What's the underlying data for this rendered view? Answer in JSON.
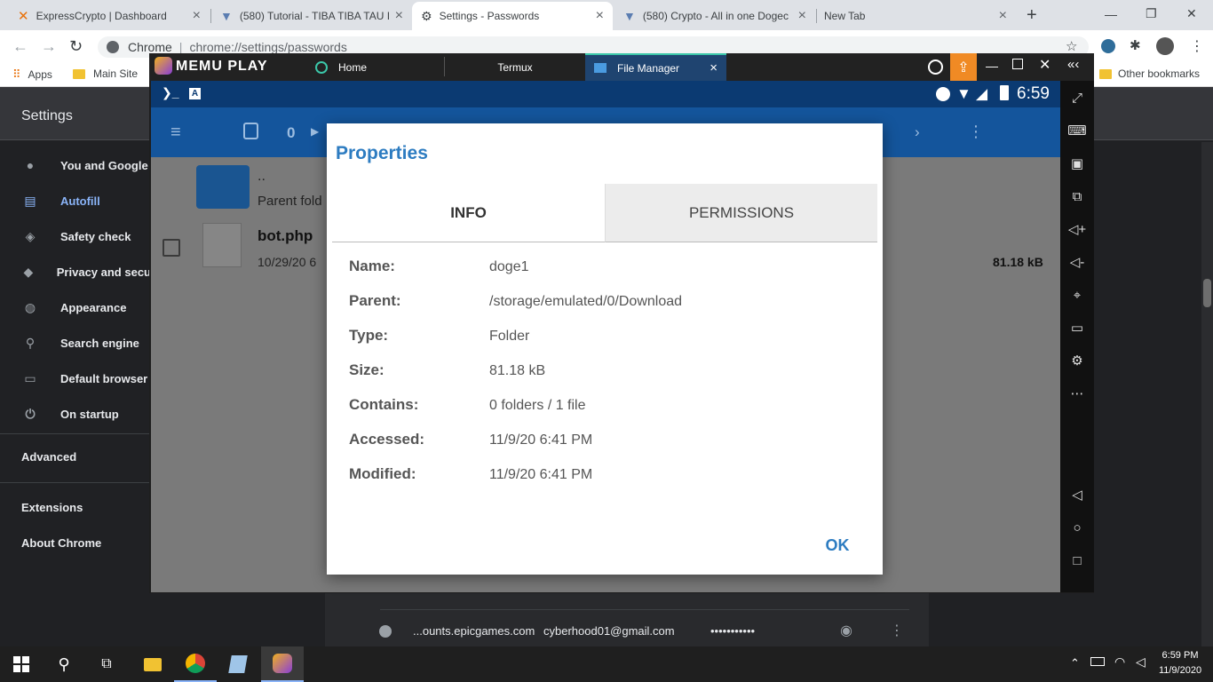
{
  "browser": {
    "tabs": [
      {
        "title": "ExpressCrypto | Dashboard",
        "icon": "expresscrypto-icon"
      },
      {
        "title": "(580) Tutorial - TIBA TIBA TAU I",
        "icon": "youtube-icon"
      },
      {
        "title": "Settings - Passwords",
        "icon": "gear-icon"
      },
      {
        "title": "(580) Crypto - All in one Dogec",
        "icon": "youtube-icon"
      },
      {
        "title": "New Tab",
        "icon": ""
      }
    ],
    "new_tab": "+",
    "window_controls": {
      "minimize": "—",
      "restore": "❐",
      "close": "✕"
    },
    "site_label": "Chrome",
    "url": "chrome://settings/passwords",
    "bookmarks": {
      "apps": "Apps",
      "main_site": "Main Site",
      "other": "Other bookmarks"
    }
  },
  "settings": {
    "title": "Settings",
    "nav": [
      {
        "label": "You and Google",
        "icon": "person-icon"
      },
      {
        "label": "Autofill",
        "icon": "clipboard-icon",
        "active": true
      },
      {
        "label": "Safety check",
        "icon": "shield-check-icon"
      },
      {
        "label": "Privacy and secu",
        "icon": "shield-icon"
      },
      {
        "label": "Appearance",
        "icon": "palette-icon"
      },
      {
        "label": "Search engine",
        "icon": "search-icon"
      },
      {
        "label": "Default browser",
        "icon": "browser-icon"
      },
      {
        "label": "On startup",
        "icon": "power-icon"
      }
    ],
    "advanced": "Advanced",
    "extensions": "Extensions",
    "about": "About Chrome",
    "password_row": {
      "site": "...ounts.epicgames.com",
      "user": "cyberhood01@gmail.com",
      "password": "•••••••••••"
    }
  },
  "memu": {
    "brand": "MEMU PLAY",
    "tabs": [
      {
        "label": "Home"
      },
      {
        "label": "Termux"
      },
      {
        "label": "File Manager"
      }
    ],
    "status_time": "6:59",
    "toolbar_count": "0",
    "files": [
      {
        "name": "..",
        "sub": "Parent fold"
      },
      {
        "name": "bot.php",
        "sub": "10/29/20 6",
        "size": "81.18 kB"
      }
    ]
  },
  "dialog": {
    "title": "Properties",
    "tabs": {
      "info": "INFO",
      "permissions": "PERMISSIONS"
    },
    "rows": [
      {
        "label": "Name:",
        "value": "doge1"
      },
      {
        "label": "Parent:",
        "value": "/storage/emulated/0/Download"
      },
      {
        "label": "Type:",
        "value": "Folder"
      },
      {
        "label": "Size:",
        "value": "81.18 kB"
      },
      {
        "label": "Contains:",
        "value": "0 folders / 1 file"
      },
      {
        "label": "Accessed:",
        "value": "11/9/20 6:41 PM"
      },
      {
        "label": "Modified:",
        "value": "11/9/20 6:41 PM"
      }
    ],
    "ok": "OK"
  },
  "taskbar": {
    "time": "6:59 PM",
    "date": "11/9/2020"
  }
}
